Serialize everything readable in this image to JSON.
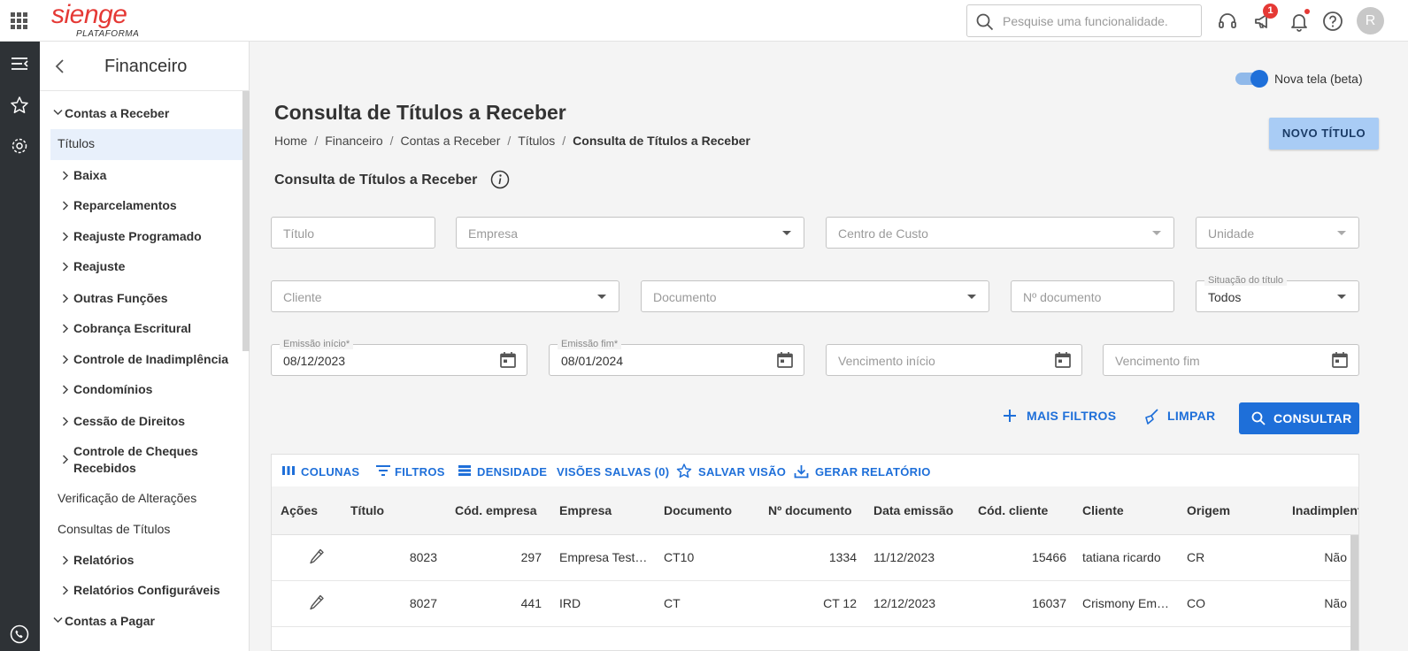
{
  "app": {
    "logo_main": "sienge",
    "logo_sub": "PLATAFORMA",
    "search_placeholder": "Pesquise uma funcionalidade.",
    "notification_count": "1",
    "avatar_initial": "R",
    "accent": "#1e6fd9",
    "brand": "#e53935"
  },
  "sidebar": {
    "title": "Financeiro",
    "items": [
      {
        "label": "Contas a Receber"
      },
      {
        "label": "Títulos"
      },
      {
        "label": "Baixa"
      },
      {
        "label": "Reparcelamentos"
      },
      {
        "label": "Reajuste Programado"
      },
      {
        "label": "Reajuste"
      },
      {
        "label": "Outras Funções"
      },
      {
        "label": "Cobrança Escritural"
      },
      {
        "label": "Controle de Inadimplência"
      },
      {
        "label": "Condomínios"
      },
      {
        "label": "Cessão de Direitos"
      },
      {
        "label": "Controle de Cheques"
      },
      {
        "label": "Recebidos"
      },
      {
        "label": "Verificação de Alterações"
      },
      {
        "label": "Consultas de Títulos"
      },
      {
        "label": "Relatórios"
      },
      {
        "label": "Relatórios Configuráveis"
      },
      {
        "label": "Contas a Pagar"
      }
    ]
  },
  "main": {
    "toggle_label": "Nova tela (beta)",
    "toggle_on": true,
    "title": "Consulta de Títulos a Receber",
    "breadcrumb": [
      "Home",
      "Financeiro",
      "Contas a Receber",
      "Títulos",
      "Consulta de Títulos a Receber"
    ],
    "breadcrumb_sep": "/",
    "new_button": "NOVO TÍTULO",
    "section_title": "Consulta de Títulos a Receber"
  },
  "filters": {
    "titulo": {
      "placeholder": "Título"
    },
    "empresa": {
      "placeholder": "Empresa"
    },
    "centro_custo": {
      "placeholder": "Centro de Custo"
    },
    "unidade": {
      "placeholder": "Unidade"
    },
    "cliente": {
      "placeholder": "Cliente"
    },
    "documento": {
      "placeholder": "Documento"
    },
    "num_documento": {
      "placeholder": "Nº documento"
    },
    "situacao": {
      "label": "Situação do título",
      "value": "Todos"
    },
    "emissao_inicio": {
      "label": "Emissão início*",
      "value": "08/12/2023"
    },
    "emissao_fim": {
      "label": "Emissão fim*",
      "value": "08/01/2024"
    },
    "vencimento_inicio": {
      "placeholder": "Vencimento início"
    },
    "vencimento_fim": {
      "placeholder": "Vencimento fim"
    },
    "more_filters": "MAIS FILTROS",
    "clear": "LIMPAR",
    "submit": "CONSULTAR"
  },
  "grid": {
    "toolbar": {
      "columns": "COLUNAS",
      "filters": "FILTROS",
      "density": "DENSIDADE",
      "saved_views": "VISÕES SALVAS (0)",
      "save_view": "SALVAR VISÃO",
      "report": "GERAR RELATÓRIO"
    },
    "columns": [
      "Ações",
      "Título",
      "Cód. empresa",
      "Empresa",
      "Documento",
      "Nº documento",
      "Data emissão",
      "Cód. cliente",
      "Cliente",
      "Origem",
      "Inadimplent"
    ],
    "rows": [
      {
        "titulo": "8023",
        "cod_empresa": "297",
        "empresa": "Empresa Test…",
        "documento": "CT10",
        "num_documento": "1334",
        "data_emissao": "11/12/2023",
        "cod_cliente": "15466",
        "cliente": "tatiana ricardo",
        "origem": "CR",
        "inadimplente": "Não"
      },
      {
        "titulo": "8027",
        "cod_empresa": "441",
        "empresa": "IRD",
        "documento": "CT",
        "num_documento": "CT 12",
        "data_emissao": "12/12/2023",
        "cod_cliente": "16037",
        "cliente": "Crismony Em…",
        "origem": "CO",
        "inadimplente": "Não"
      }
    ]
  }
}
